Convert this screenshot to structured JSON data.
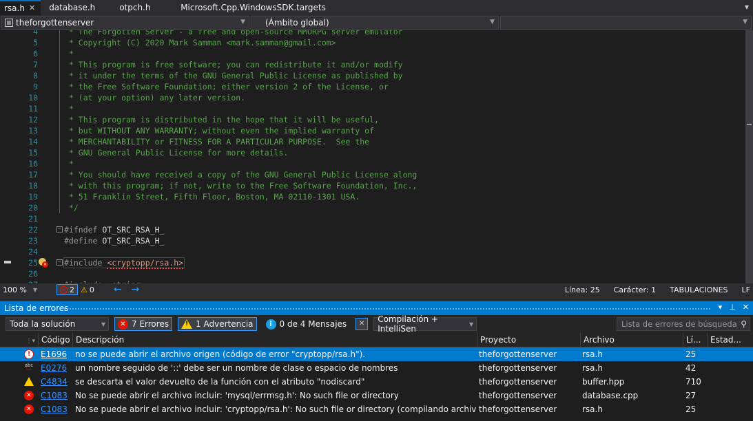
{
  "tabs": [
    {
      "label": "rsa.h",
      "active": true
    },
    {
      "label": "database.h",
      "active": false
    },
    {
      "label": "otpch.h",
      "active": false
    },
    {
      "label": "Microsoft.Cpp.WindowsSDK.targets",
      "active": false
    }
  ],
  "tab_overflow_icon": "chevron-down-icon",
  "nav": {
    "project": "theforgottenserver",
    "scope": "(Ámbito global)",
    "member": ""
  },
  "code_lines": [
    {
      "num": "4",
      "text": " * The Forgotten Server - a free and open-source MMORPG server emulator"
    },
    {
      "num": "5",
      "text": " * Copyright (C) 2020 Mark Samman <mark.samman@gmail.com>"
    },
    {
      "num": "6",
      "text": " *"
    },
    {
      "num": "7",
      "text": " * This program is free software; you can redistribute it and/or modify"
    },
    {
      "num": "8",
      "text": " * it under the terms of the GNU General Public License as published by"
    },
    {
      "num": "9",
      "text": " * the Free Software Foundation; either version 2 of the License, or"
    },
    {
      "num": "10",
      "text": " * (at your option) any later version."
    },
    {
      "num": "11",
      "text": " *"
    },
    {
      "num": "12",
      "text": " * This program is distributed in the hope that it will be useful,"
    },
    {
      "num": "13",
      "text": " * but WITHOUT ANY WARRANTY; without even the implied warranty of"
    },
    {
      "num": "14",
      "text": " * MERCHANTABILITY or FITNESS FOR A PARTICULAR PURPOSE.  See the"
    },
    {
      "num": "15",
      "text": " * GNU General Public License for more details."
    },
    {
      "num": "16",
      "text": " *"
    },
    {
      "num": "17",
      "text": " * You should have received a copy of the GNU General Public License along"
    },
    {
      "num": "18",
      "text": " * with this program; if not, write to the Free Software Foundation, Inc.,"
    },
    {
      "num": "19",
      "text": " * 51 Franklin Street, Fifth Floor, Boston, MA 02110-1301 USA."
    },
    {
      "num": "20",
      "text": " */"
    },
    {
      "num": "21",
      "text": ""
    },
    {
      "num": "22",
      "directive": "#ifndef",
      "macro": "OT_SRC_RSA_H_"
    },
    {
      "num": "23",
      "directive": "#define",
      "macro": "OT_SRC_RSA_H_"
    },
    {
      "num": "24",
      "text": ""
    },
    {
      "num": "25",
      "directive": "#include",
      "str": "<cryptopp/rsa.h>"
    },
    {
      "num": "26",
      "text": ""
    },
    {
      "num": "27",
      "directive": "#include",
      "str": "<string>"
    }
  ],
  "status": {
    "zoom": "100 %",
    "errors": "2",
    "warnings": "0",
    "line": "Línea: 25",
    "char": "Carácter: 1",
    "indent": "TABULACIONES",
    "eol": "LF"
  },
  "panel": {
    "title": "Lista de errores",
    "controls": [
      "▾",
      "⊥",
      "✕"
    ]
  },
  "toolbar": {
    "scope": "Toda la solución",
    "errors_btn": "7 Errores",
    "warnings_btn": "1 Advertencia",
    "messages_btn": "0 de 4 Mensajes",
    "build_filter": "Compilación + IntelliSen",
    "search_placeholder": "Lista de errores de búsqueda"
  },
  "columns": [
    "",
    "Código",
    "Descripción",
    "Proyecto",
    "Archivo",
    "Lí...",
    "Estad..."
  ],
  "errors": [
    {
      "icon": "error-outline-icon",
      "code": "E1696",
      "desc": "no se puede abrir el archivo origen (código de error \"cryptopp/rsa.h\").",
      "project": "theforgottenserver",
      "file": "rsa.h",
      "line": "25",
      "selected": true
    },
    {
      "icon": "spelling-error-icon",
      "code": "E0276",
      "desc": "un nombre seguido de '::' debe ser un nombre de clase o espacio de nombres",
      "project": "theforgottenserver",
      "file": "rsa.h",
      "line": "42",
      "selected": false
    },
    {
      "icon": "warning-icon",
      "code": "C4834",
      "desc": "se descarta el valor devuelto de la función con el atributo \"nodiscard\"",
      "project": "theforgottenserver",
      "file": "buffer.hpp",
      "line": "710",
      "selected": false
    },
    {
      "icon": "error-icon",
      "code": "C1083",
      "desc": "No se puede abrir el archivo incluir: 'mysql/errmsg.h': No such file or directory",
      "project": "theforgottenserver",
      "file": "database.cpp",
      "line": "27",
      "selected": false
    },
    {
      "icon": "error-icon",
      "code": "C1083",
      "desc": "No se puede abrir el archivo incluir: 'cryptopp/rsa.h': No such file or directory (compilando archivo de origen ..",
      "project": "theforgottenserver",
      "file": "rsa.h",
      "line": "25",
      "selected": false
    }
  ]
}
